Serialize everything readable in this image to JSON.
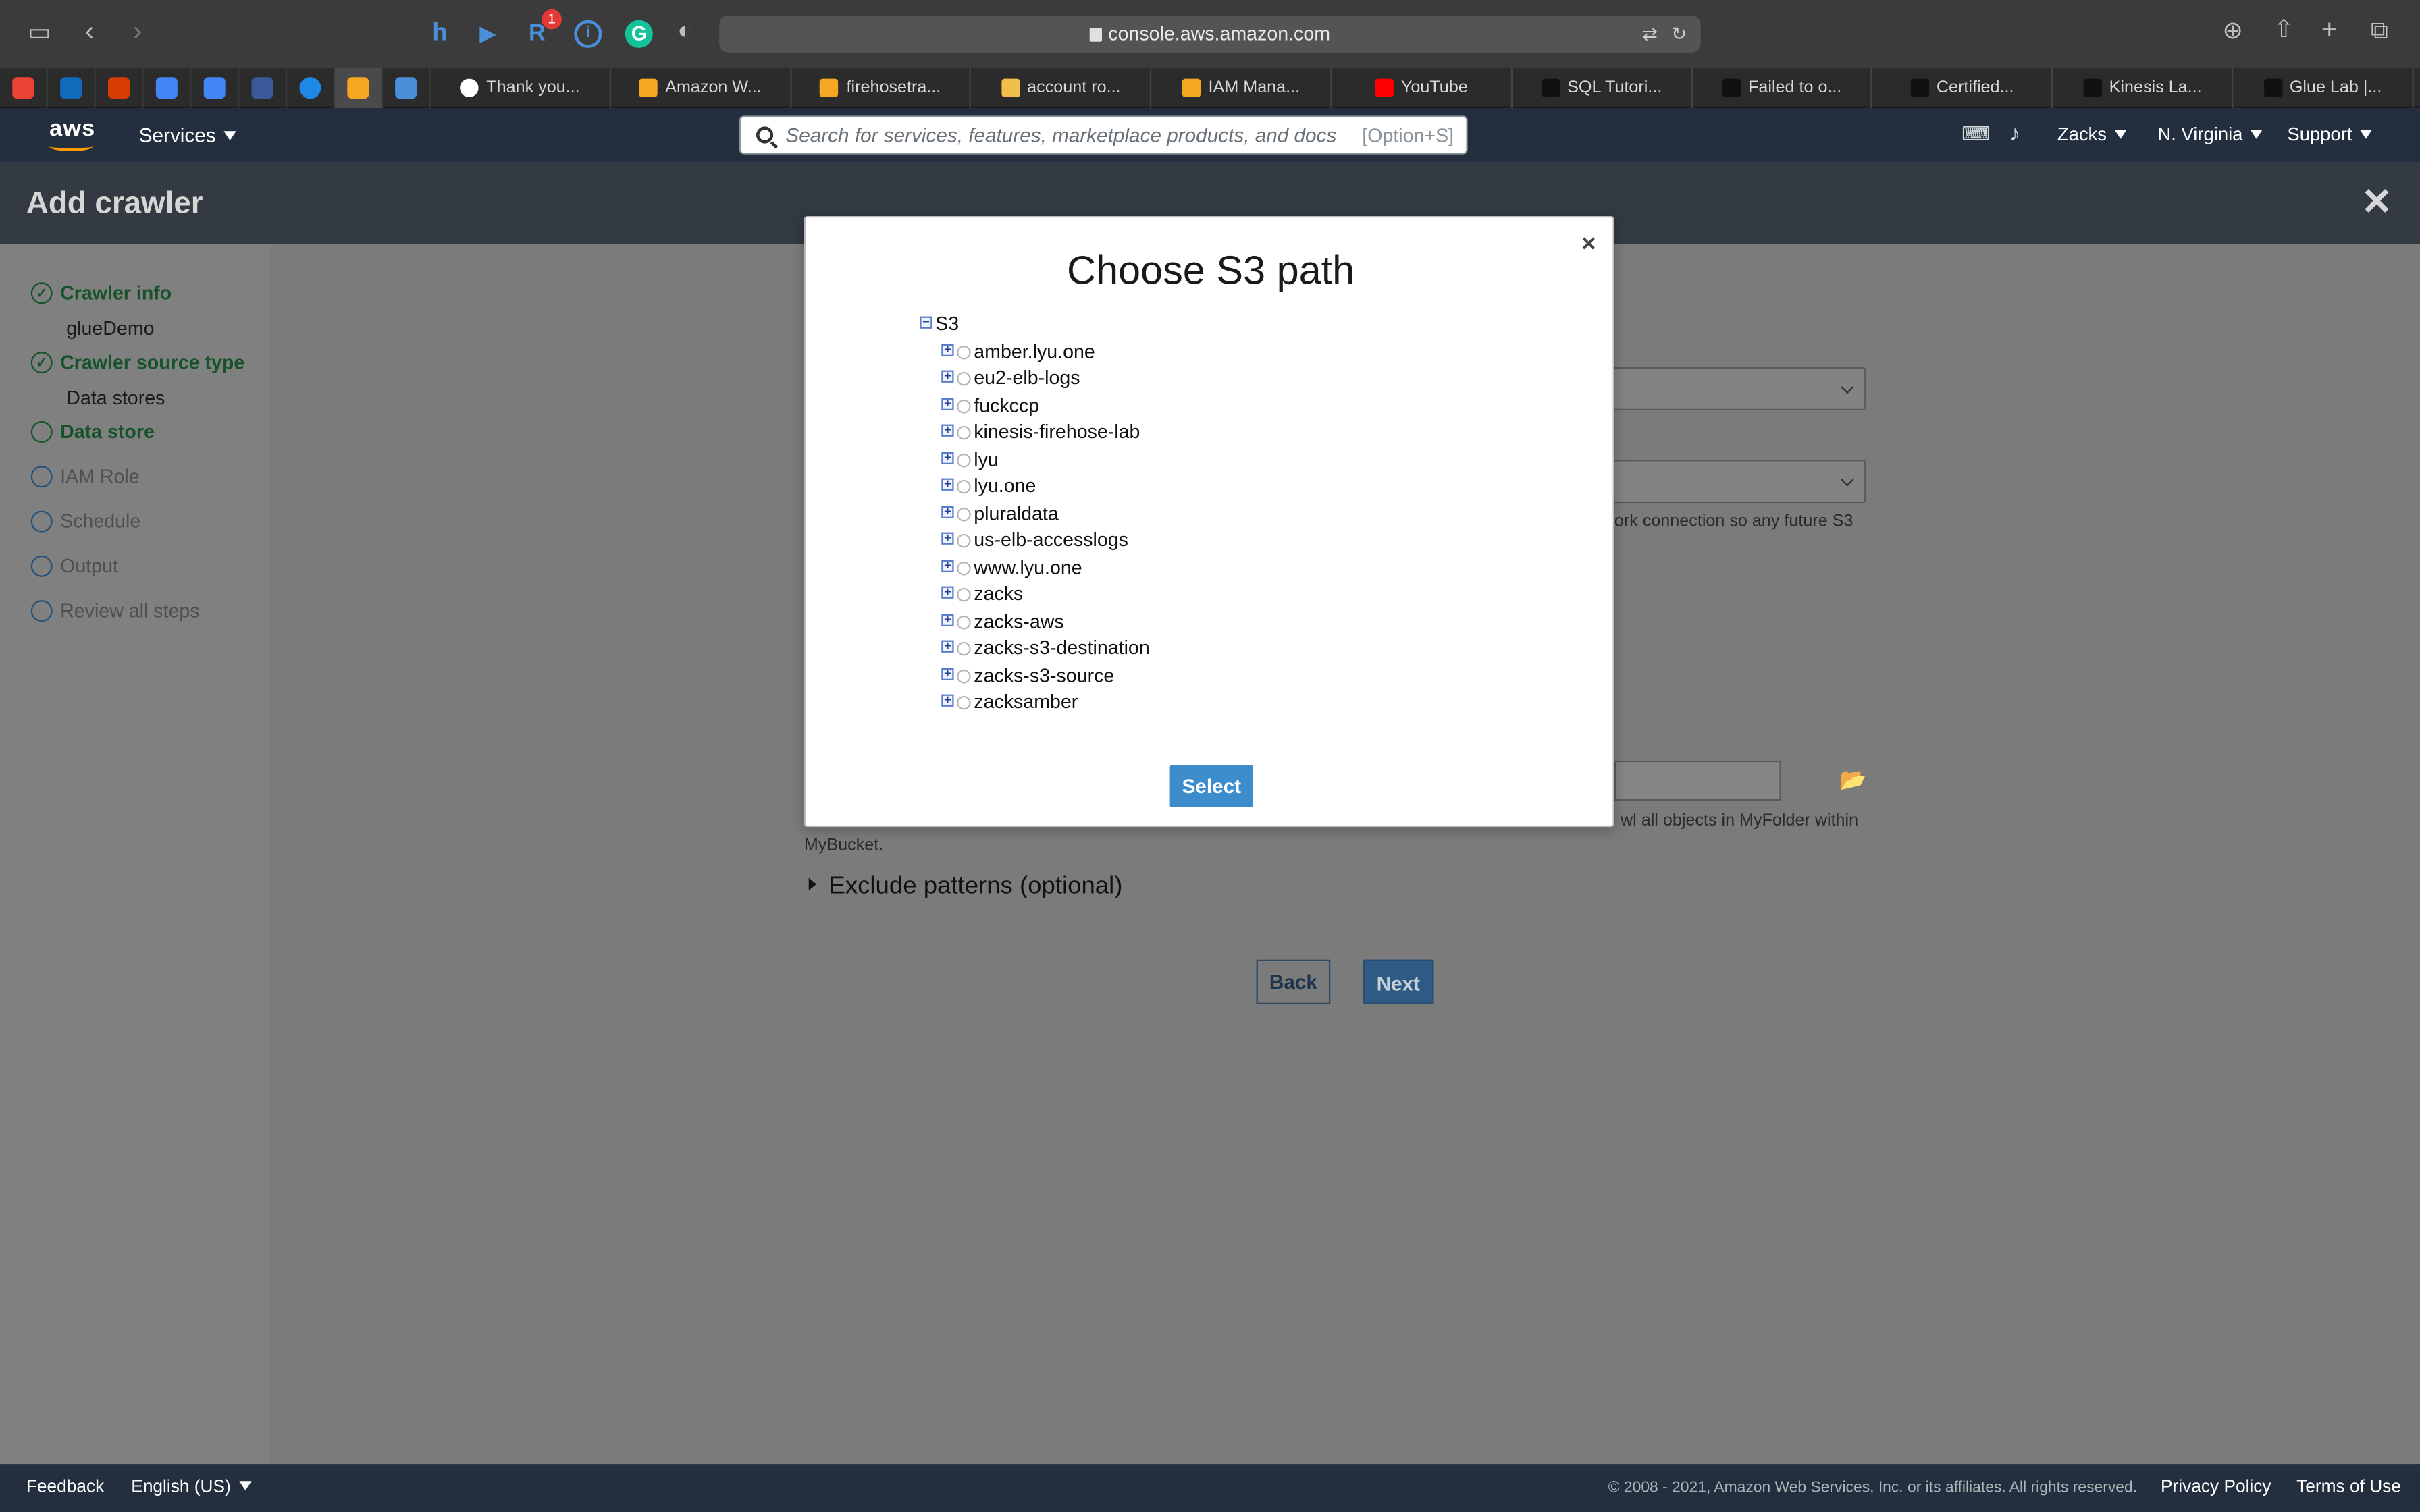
{
  "browser": {
    "url": "console.aws.amazon.com",
    "ext_badge": "1",
    "tabs": [
      {
        "label": "Thank you...",
        "color": "#ffffff"
      },
      {
        "label": "Amazon W...",
        "color": "#f5a623"
      },
      {
        "label": "firehosetra...",
        "color": "#f5a623"
      },
      {
        "label": "account ro...",
        "color": "#f0c04a"
      },
      {
        "label": "IAM Mana...",
        "color": "#f5a623"
      },
      {
        "label": "YouTube",
        "color": "#ff0000"
      },
      {
        "label": "SQL Tutori...",
        "color": "#111111"
      },
      {
        "label": "Failed to o...",
        "color": "#111111"
      },
      {
        "label": "Certified...",
        "color": "#111111"
      },
      {
        "label": "Kinesis La...",
        "color": "#111111"
      },
      {
        "label": "Glue Lab |...",
        "color": "#111111"
      }
    ]
  },
  "awsnav": {
    "logo": "aws",
    "services": "Services",
    "search_placeholder": "Search for services, features, marketplace products, and docs",
    "search_shortcut": "[Option+S]",
    "user": "Zacks",
    "region": "N. Virginia",
    "support": "Support"
  },
  "page": {
    "title": "Add crawler",
    "sidebar": {
      "steps": [
        {
          "label": "Crawler info",
          "sub": "glueDemo",
          "state": "done"
        },
        {
          "label": "Crawler source type",
          "sub": "Data stores",
          "state": "done"
        },
        {
          "label": "Data store",
          "state": "current"
        },
        {
          "label": "IAM Role",
          "state": "todo"
        },
        {
          "label": "Schedule",
          "state": "todo"
        },
        {
          "label": "Output",
          "state": "todo"
        },
        {
          "label": "Review all steps",
          "state": "todo"
        }
      ]
    },
    "hint_connection": "ork connection so any future S3",
    "hint_include_a": "wl all objects in MyFolder within",
    "hint_include_b": "MyBucket.",
    "exclude": "Exclude patterns (optional)",
    "back": "Back",
    "next": "Next"
  },
  "modal": {
    "title": "Choose S3 path",
    "close": "×",
    "root": "S3",
    "buckets": [
      "amber.lyu.one",
      "eu2-elb-logs",
      "fuckccp",
      "kinesis-firehose-lab",
      "lyu",
      "lyu.one",
      "pluraldata",
      "us-elb-accesslogs",
      "www.lyu.one",
      "zacks",
      "zacks-aws",
      "zacks-s3-destination",
      "zacks-s3-source",
      "zacksamber"
    ],
    "select": "Select"
  },
  "footer": {
    "feedback": "Feedback",
    "language": "English (US)",
    "copyright": "© 2008 - 2021, Amazon Web Services, Inc. or its affiliates. All rights reserved.",
    "privacy": "Privacy Policy",
    "terms": "Terms of Use"
  }
}
